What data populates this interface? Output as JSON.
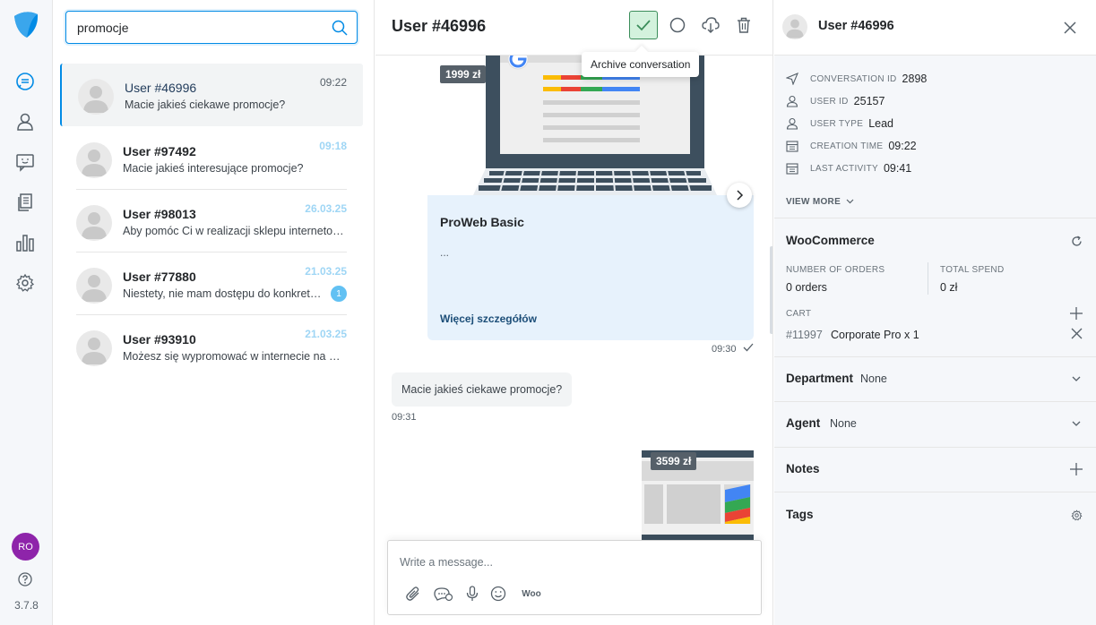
{
  "app": {
    "version": "3.7.8",
    "user_initials": "RO",
    "brand_color": "#028be5",
    "nav_icons": [
      "chat-icon",
      "users-icon",
      "message-icon",
      "articles-icon",
      "reports-icon",
      "settings-icon"
    ]
  },
  "search": {
    "value": "promocje"
  },
  "conversations": [
    {
      "name": "User #46996",
      "time": "09:22",
      "message": "Macie jakieś ciekawe promocje?",
      "active": true
    },
    {
      "name": "User #97492",
      "time": "09:18",
      "message": "Macie jakieś interesujące promocje?"
    },
    {
      "name": "User #98013",
      "time": "26.03.25",
      "message": "Aby pomóc Ci w realizacji sklepu internetowego..."
    },
    {
      "name": "User #77880",
      "time": "21.03.25",
      "message": "Niestety, nie mam dostępu do konkretnych...",
      "badge": "1"
    },
    {
      "name": "User #93910",
      "time": "21.03.25",
      "message": "Możesz się wypromować w internecie na wiele sposobów"
    }
  ],
  "chat": {
    "title": "User #46996",
    "tooltip": "Archive conversation",
    "product_price": "1999 zł",
    "product_title": "ProWeb Basic",
    "product_desc": "...",
    "product_link": "Więcej szczegółów",
    "product_time": "09:30",
    "user_message": "Macie jakieś ciekawe promocje?",
    "user_message_time": "09:31",
    "second_price": "3599 zł",
    "composer_placeholder": "Write a message...",
    "woo_label": "Woo"
  },
  "details": {
    "title": "User #46996",
    "fields": [
      {
        "icon": "send-icon",
        "label": "Conversation ID",
        "value": "2898"
      },
      {
        "icon": "user-icon",
        "label": "User ID",
        "value": "25157"
      },
      {
        "icon": "user-icon",
        "label": "User type",
        "value": "Lead"
      },
      {
        "icon": "calendar-icon",
        "label": "Creation time",
        "value": "09:22"
      },
      {
        "icon": "calendar-icon",
        "label": "Last activity",
        "value": "09:41"
      }
    ],
    "view_more": "VIEW MORE",
    "woocommerce": {
      "title": "WooCommerce",
      "orders_label": "Number of orders",
      "orders_value": "0 orders",
      "spend_label": "Total spend",
      "spend_value": "0 zł",
      "cart_label": "Cart",
      "cart_item_id": "#11997",
      "cart_item_name": "Corporate Pro x 1"
    },
    "department": {
      "label": "Department",
      "value": "None"
    },
    "agent": {
      "label": "Agent",
      "value": "None"
    },
    "notes": {
      "label": "Notes"
    },
    "tags": {
      "label": "Tags"
    }
  }
}
